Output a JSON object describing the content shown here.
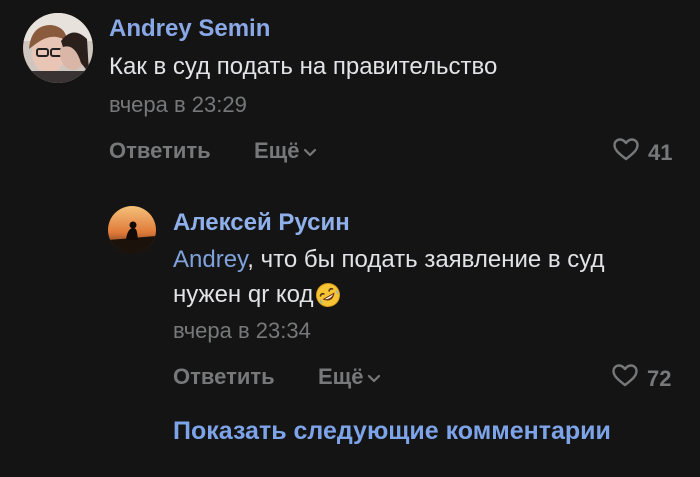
{
  "comments": [
    {
      "author": "Andrey Semin",
      "text": "Как в суд подать на правительство",
      "time": "вчера в 23:29",
      "reply_label": "Ответить",
      "more_label": "Ещё",
      "likes": "41"
    }
  ],
  "replies": [
    {
      "author": "Алексей Русин",
      "mention": "Andrey",
      "text_line1": ", что бы подать заявление в суд",
      "text_line2": "нужен qr код",
      "emoji": "rofl-emoji",
      "time": "вчера в 23:34",
      "reply_label": "Ответить",
      "more_label": "Ещё",
      "likes": "72"
    }
  ],
  "show_more_label": "Показать следующие комментарии",
  "colors": {
    "background": "#141414",
    "author": "#8ab4f8",
    "text": "#e1e3e6",
    "secondary": "#76787a",
    "link": "#7da3e8"
  },
  "icons": {
    "heart": "heart-outline-icon",
    "chevron": "chevron-down-icon"
  }
}
